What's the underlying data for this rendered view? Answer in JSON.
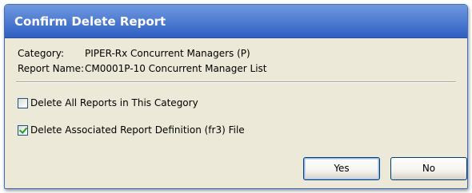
{
  "dialog": {
    "title": "Confirm Delete Report",
    "category_label": "Category:",
    "category_value": "PIPER-Rx Concurrent Managers (P)",
    "report_name_label": "Report Name:",
    "report_name_value": "CM0001P-10 Concurrent Manager List",
    "options": [
      {
        "label": "Delete All Reports in This Category",
        "checked": false
      },
      {
        "label": "Delete Associated Report Definition (fr3) File",
        "checked": true
      }
    ],
    "buttons": {
      "yes": "Yes",
      "no": "No"
    }
  },
  "colors": {
    "title_bar": "#4f7cd1",
    "dialog_bg": "#ece9d8",
    "check_green": "#21a121"
  }
}
